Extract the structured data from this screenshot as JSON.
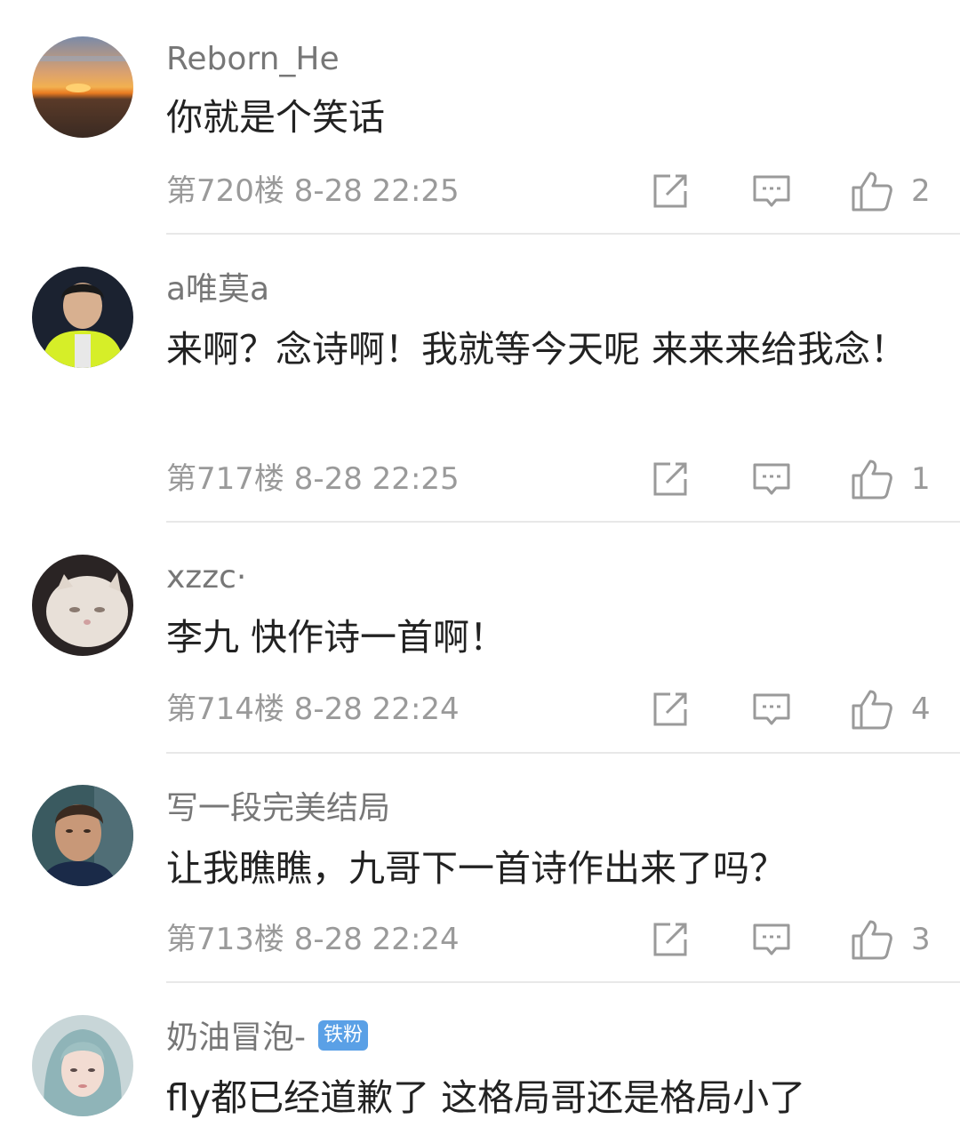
{
  "comments": [
    {
      "username": "Reborn_He",
      "badge": "",
      "content": "你就是个笑话",
      "meta": "第720楼 8-28 22:25",
      "likes": "2"
    },
    {
      "username": "a唯莫a",
      "badge": "",
      "content": "来啊？念诗啊！我就等今天呢 来来来给我念！",
      "meta": "第717楼 8-28 22:25",
      "likes": "1"
    },
    {
      "username": "xzzc·",
      "badge": "",
      "content": "李九 快作诗一首啊！",
      "meta": "第714楼 8-28 22:24",
      "likes": "4"
    },
    {
      "username": "写一段完美结局",
      "badge": "",
      "content": "让我瞧瞧，九哥下一首诗作出来了吗？",
      "meta": "第713楼 8-28 22:24",
      "likes": "3"
    },
    {
      "username": "奶油冒泡-",
      "badge": "铁粉",
      "content": "fly都已经道歉了 这格局哥还是格局小了",
      "meta": "",
      "likes": ""
    }
  ],
  "icons": {
    "reply": "share-edit-icon",
    "comment": "comment-bubble-icon",
    "like": "thumbs-up-icon"
  },
  "colors": {
    "username": "#777777",
    "content": "#222222",
    "meta": "#9a9a9a",
    "badge": "#5aa0e6",
    "divider": "#e8e8e8"
  }
}
